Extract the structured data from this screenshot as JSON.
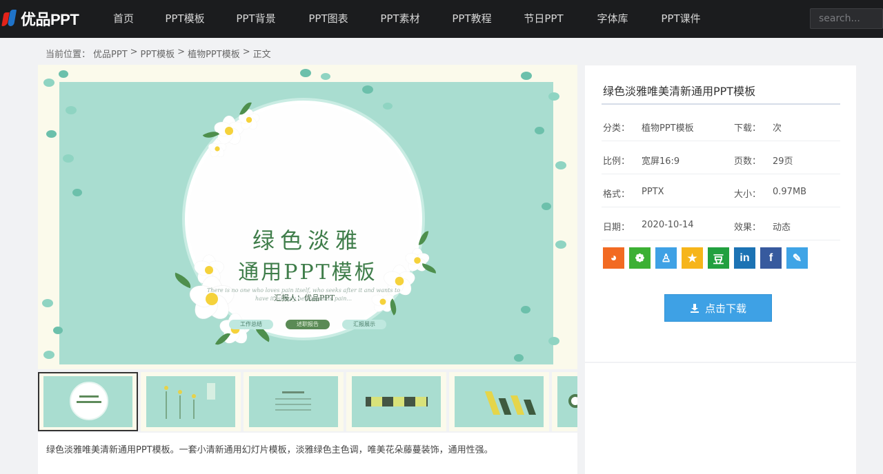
{
  "brand": {
    "name": "优品PPT"
  },
  "nav": {
    "items": [
      "首页",
      "PPT模板",
      "PPT背景",
      "PPT图表",
      "PPT素材",
      "PPT教程",
      "节日PPT",
      "字体库",
      "PPT课件"
    ],
    "search_placeholder": "search..."
  },
  "breadcrumb": {
    "label": "当前位置：",
    "items": [
      "优品PPT",
      "PPT模板",
      "植物PPT模板",
      "正文"
    ],
    "separator": ">"
  },
  "preview": {
    "title_line1": "绿色淡雅",
    "title_line2": "通用PPT模板",
    "subtitle": "There is no one who loves pain itself, who seeks after it and wants to have it, simply because it is pain...",
    "pills": [
      "工作总结",
      "述职报告",
      "汇报展示"
    ],
    "author": "汇报人：优品PPT"
  },
  "thumbnails": {
    "count": 6,
    "active_index": 0
  },
  "description": "绿色淡雅唯美清新通用PPT模板。一套小清新通用幻灯片模板，淡雅绿色主色调，唯美花朵藤蔓装饰，通用性强。",
  "info": {
    "title": "绿色淡雅唯美清新通用PPT模板",
    "rows": [
      {
        "k1": "分类：",
        "v1": "植物PPT模板",
        "k2": "下载：",
        "v2": "次"
      },
      {
        "k1": "比例：",
        "v1": "宽屏16:9",
        "k2": "页数：",
        "v2": "29页"
      },
      {
        "k1": "格式：",
        "v1": "PPTX",
        "k2": "大小：",
        "v2": "0.97MB"
      },
      {
        "k1": "日期：",
        "v1": "2020-10-14",
        "k2": "效果：",
        "v2": "动态"
      }
    ],
    "share": [
      {
        "name": "weibo-icon",
        "glyph": "◕",
        "color": "#f26a22"
      },
      {
        "name": "wechat-icon",
        "glyph": "❁",
        "color": "#3cb034"
      },
      {
        "name": "qq-icon",
        "glyph": "♙",
        "color": "#3ea1e5"
      },
      {
        "name": "qzone-icon",
        "glyph": "★",
        "color": "#f6b51a"
      },
      {
        "name": "douban-icon",
        "glyph": "豆",
        "color": "#22a03f"
      },
      {
        "name": "linkedin-icon",
        "glyph": "in",
        "color": "#1c73b4"
      },
      {
        "name": "facebook-icon",
        "glyph": "f",
        "color": "#375a9e"
      },
      {
        "name": "twitter-icon",
        "glyph": "✎",
        "color": "#3fa4e6"
      }
    ],
    "download_label": "点击下载"
  }
}
